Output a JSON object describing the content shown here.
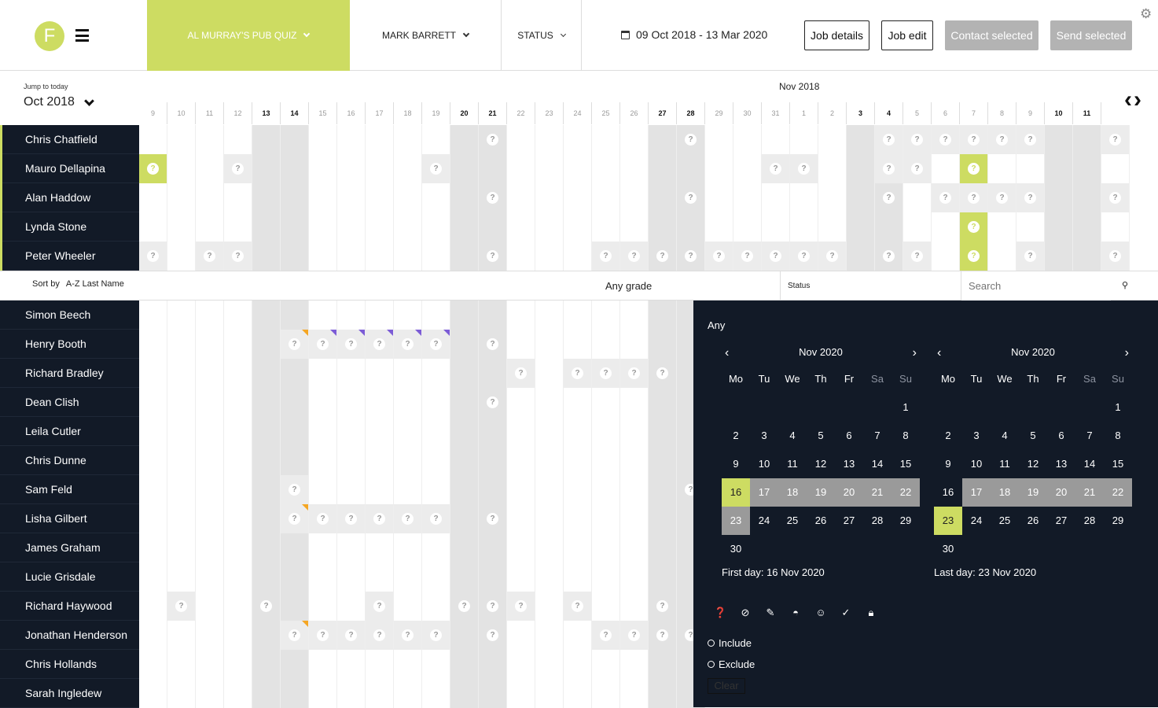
{
  "header": {
    "logo_letter": "F",
    "quiz": "AL MURRAY'S PUB QUIZ",
    "person": "MARK BARRETT",
    "status": "STATUS",
    "date_range": "09 Oct 2018 - 13 Mar 2020",
    "buttons": {
      "job_details": "Job details",
      "job_edit": "Job edit",
      "contact_selected": "Contact selected",
      "send_selected": "Send selected"
    },
    "accent": "#cddc62"
  },
  "jump": {
    "label": "Jump to today",
    "month": "Oct 2018"
  },
  "timeline": {
    "month_label": "Nov 2018",
    "days": [
      "9",
      "10",
      "11",
      "12",
      "13",
      "14",
      "15",
      "16",
      "17",
      "18",
      "19",
      "20",
      "21",
      "22",
      "23",
      "24",
      "25",
      "26",
      "27",
      "28",
      "29",
      "30",
      "31",
      "1",
      "2",
      "3",
      "4",
      "5",
      "6",
      "7",
      "8",
      "9",
      "10",
      "11"
    ]
  },
  "top_people": [
    "Chris Chatfield",
    "Mauro Dellapina",
    "Alan Haddow",
    "Lynda Stone",
    "Peter Wheeler"
  ],
  "sortbar": {
    "sort_label": "Sort by",
    "sort_value": "A-Z Last Name",
    "grade": "Any grade",
    "status": "Status",
    "search_placeholder": "Search"
  },
  "bottom_people": [
    "Simon Beech",
    "Henry Booth",
    "Richard Bradley",
    "Dean Clish",
    "Leila Cutler",
    "Chris Dunne",
    "Sam Feld",
    "Lisha Gilbert",
    "James Graham",
    "Lucie Grisdale",
    "Richard Haywood",
    "Jonathan Henderson",
    "Chris Hollands",
    "Sarah Ingledew"
  ],
  "panel": {
    "any": "Any",
    "weekdays": [
      "Mo",
      "Tu",
      "We",
      "Th",
      "Fr",
      "Sa",
      "Su"
    ],
    "left_cal": {
      "month": "Nov 2020",
      "first_day_label": "First day: 16 Nov 2020"
    },
    "right_cal": {
      "month": "Nov 2020",
      "last_day_label": "Last day: 23 Nov 2020"
    },
    "include": "Include",
    "exclude": "Exclude",
    "clear": "Clear",
    "icons": [
      "help-icon",
      "block-icon",
      "pencil-icon",
      "face-icon",
      "smile-icon",
      "check-icon",
      "lock-icon"
    ]
  }
}
